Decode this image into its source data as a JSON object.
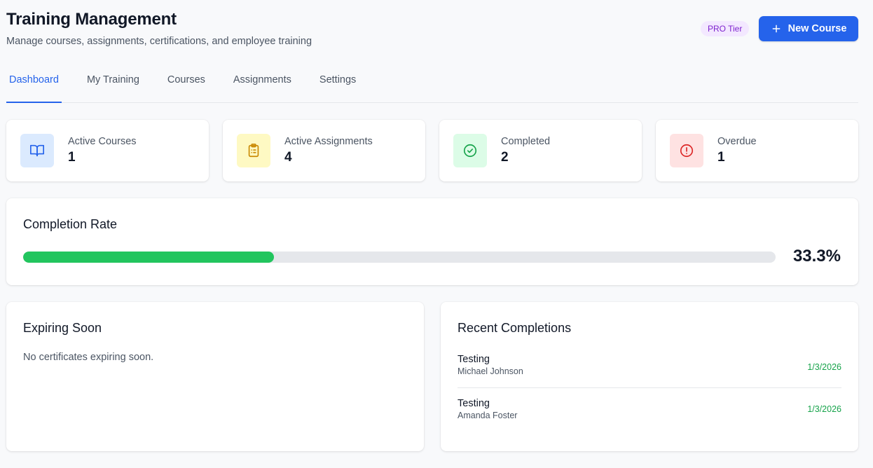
{
  "header": {
    "title": "Training Management",
    "subtitle": "Manage courses, assignments, certifications, and employee training",
    "tier_badge": "PRO Tier",
    "new_course_label": "New Course"
  },
  "tabs": [
    {
      "label": "Dashboard",
      "active": true
    },
    {
      "label": "My Training",
      "active": false
    },
    {
      "label": "Courses",
      "active": false
    },
    {
      "label": "Assignments",
      "active": false
    },
    {
      "label": "Settings",
      "active": false
    }
  ],
  "stats": [
    {
      "label": "Active Courses",
      "value": "1",
      "icon": "book-open-icon",
      "icon_bg": "#dbeafe",
      "icon_color": "#2563eb"
    },
    {
      "label": "Active Assignments",
      "value": "4",
      "icon": "clipboard-list-icon",
      "icon_bg": "#fef9c3",
      "icon_color": "#ca8a04"
    },
    {
      "label": "Completed",
      "value": "2",
      "icon": "check-circle-icon",
      "icon_bg": "#dcfce7",
      "icon_color": "#16a34a"
    },
    {
      "label": "Overdue",
      "value": "1",
      "icon": "alert-circle-icon",
      "icon_bg": "#fee2e2",
      "icon_color": "#dc2626"
    }
  ],
  "completion": {
    "title": "Completion Rate",
    "value_label": "33.3%",
    "fraction": 0.333,
    "bar_color": "#22c55e"
  },
  "expiring": {
    "title": "Expiring Soon",
    "empty_text": "No certificates expiring soon."
  },
  "recent": {
    "title": "Recent Completions",
    "items": [
      {
        "course": "Testing",
        "employee": "Michael Johnson",
        "date": "1/3/2026"
      },
      {
        "course": "Testing",
        "employee": "Amanda Foster",
        "date": "1/3/2026"
      }
    ]
  },
  "colors": {
    "accent": "#2563eb",
    "success": "#16a34a"
  }
}
